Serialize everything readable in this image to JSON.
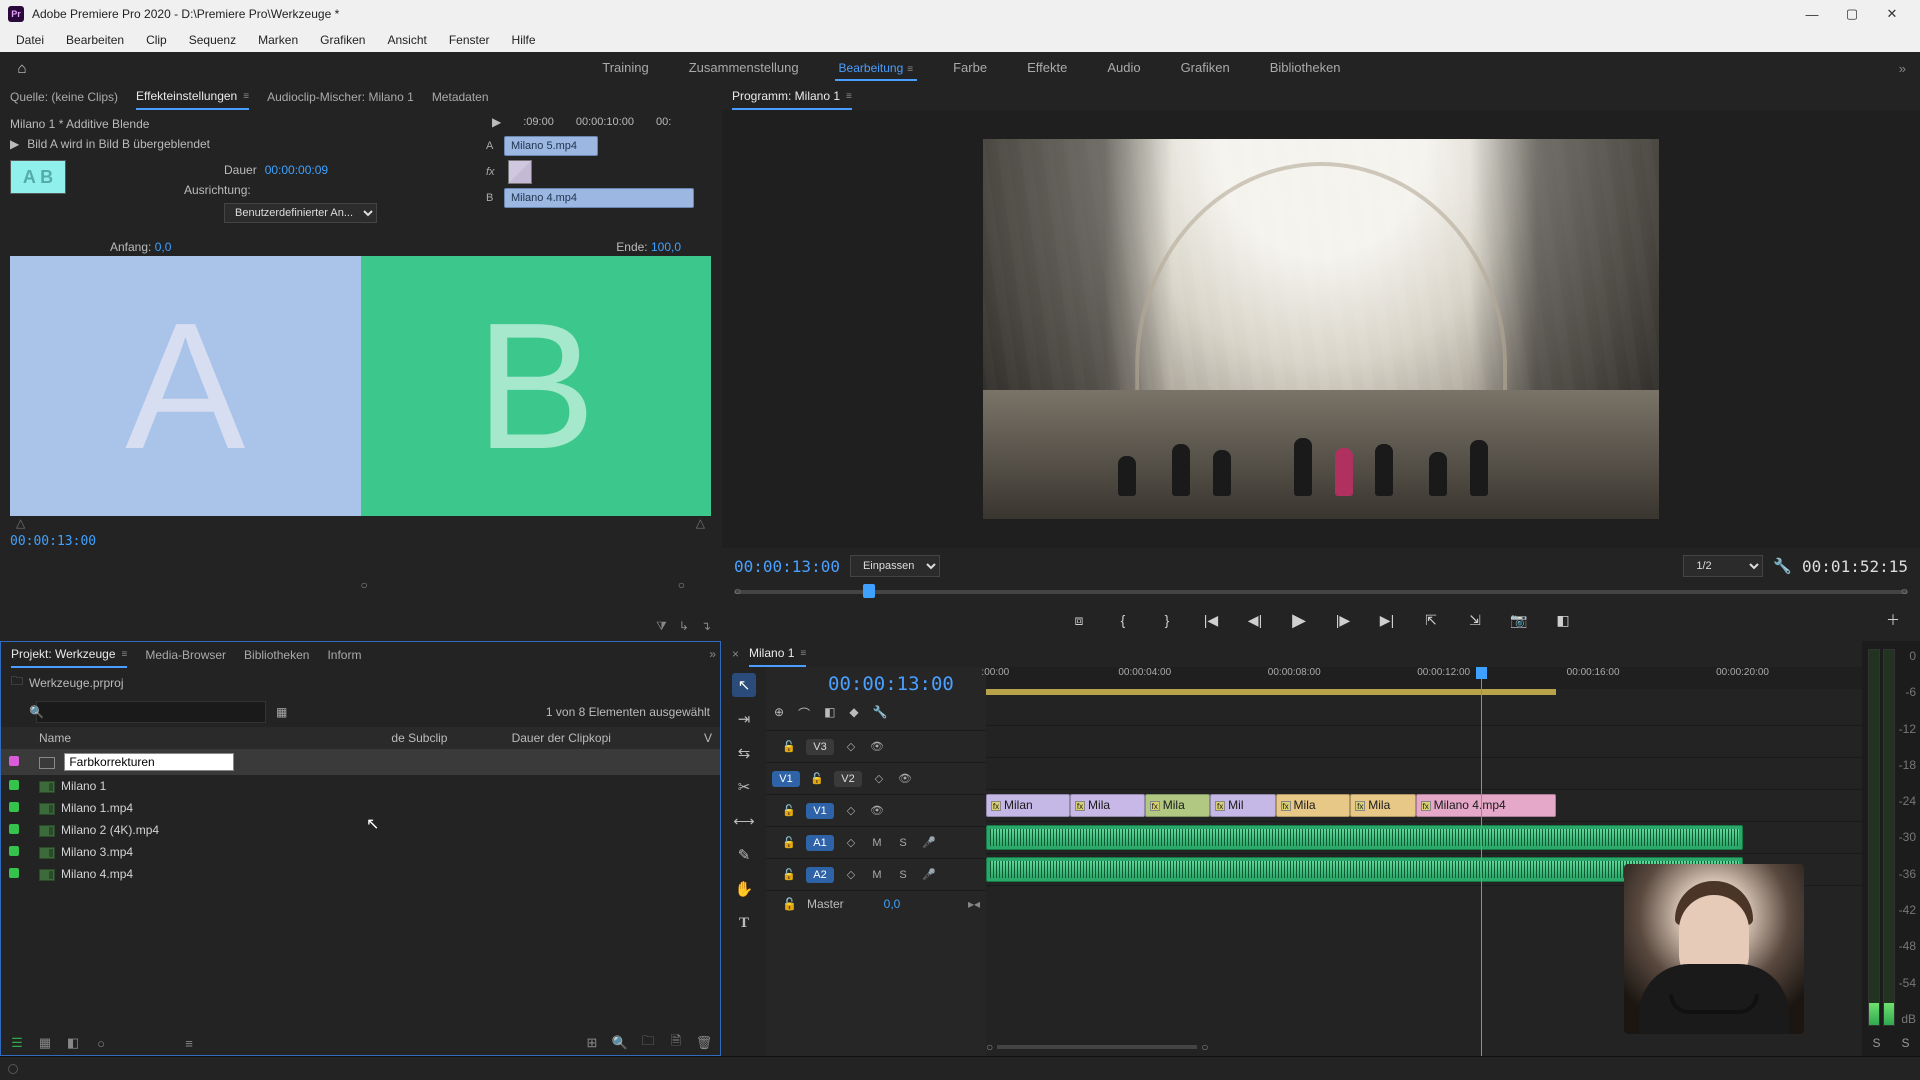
{
  "window": {
    "title": "Adobe Premiere Pro 2020 - D:\\Premiere Pro\\Werkzeuge *",
    "logo_text": "Pr"
  },
  "menu": [
    "Datei",
    "Bearbeiten",
    "Clip",
    "Sequenz",
    "Marken",
    "Grafiken",
    "Ansicht",
    "Fenster",
    "Hilfe"
  ],
  "workspaces": {
    "items": [
      "Training",
      "Zusammenstellung",
      "Bearbeitung",
      "Farbe",
      "Effekte",
      "Audio",
      "Grafiken",
      "Bibliotheken"
    ],
    "active": "Bearbeitung"
  },
  "source_tabs": {
    "items": [
      "Quelle: (keine Clips)",
      "Effekteinstellungen",
      "Audioclip-Mischer: Milano 1",
      "Metadaten"
    ],
    "active": "Effekteinstellungen"
  },
  "effect_controls": {
    "breadcrumb": "Milano 1 * Additive Blende",
    "desc": "Bild A wird in Bild B übergeblendet",
    "dauer_label": "Dauer",
    "dauer_value": "00:00:00:09",
    "ausrichtung_label": "Ausrichtung:",
    "ausrichtung_value": "Benutzerdefinierter An...",
    "anfang_label": "Anfang:",
    "anfang_value": "0,0",
    "ende_label": "Ende:",
    "ende_value": "100,0",
    "a_letter": "A",
    "b_letter": "B",
    "timecode": "00:00:13:00",
    "mini_timeline": {
      "ticks": [
        ":09:00",
        "00:00:10:00",
        "00:"
      ],
      "track_a_label": "A",
      "track_a_clip": "Milano 5.mp4",
      "fx_label": "fx",
      "track_b_label": "B",
      "track_b_clip": "Milano 4.mp4"
    }
  },
  "program": {
    "tab": "Programm: Milano 1",
    "timecode": "00:00:13:00",
    "fit_label": "Einpassen",
    "zoom_label": "1/2",
    "duration": "00:01:52:15",
    "playhead_pct": 11
  },
  "project_tabs": {
    "items": [
      "Projekt: Werkzeuge",
      "Media-Browser",
      "Bibliotheken",
      "Inform"
    ],
    "active": "Projekt: Werkzeuge"
  },
  "project": {
    "file_label": "Werkzeuge.prproj",
    "selection_text": "1 von 8 Elementen ausgewählt",
    "search_placeholder": "",
    "columns": [
      "Name",
      "de Subclip",
      "Dauer der Clipkopi",
      "V"
    ],
    "rename_value": "Farbkorrekturen",
    "items": [
      {
        "label_color": "#d85bd8",
        "icon": "adj",
        "name": "Farbkorrekturen",
        "editing": true
      },
      {
        "label_color": "#35c24d",
        "icon": "seq",
        "name": "Milano 1"
      },
      {
        "label_color": "#35c24d",
        "icon": "clip",
        "name": "Milano 1.mp4"
      },
      {
        "label_color": "#35c24d",
        "icon": "clip",
        "name": "Milano 2 (4K).mp4"
      },
      {
        "label_color": "#35c24d",
        "icon": "clip",
        "name": "Milano 3.mp4"
      },
      {
        "label_color": "#35c24d",
        "icon": "clip",
        "name": "Milano 4.mp4"
      }
    ]
  },
  "timeline": {
    "tab": "Milano 1",
    "timecode": "00:00:13:00",
    "ruler": [
      {
        "label": ":00:00",
        "pct": 1
      },
      {
        "label": "00:00:04:00",
        "pct": 17
      },
      {
        "label": "00:00:08:00",
        "pct": 33
      },
      {
        "label": "00:00:12:00",
        "pct": 49
      },
      {
        "label": "00:00:16:00",
        "pct": 65
      },
      {
        "label": "00:00:20:00",
        "pct": 81
      }
    ],
    "playhead_pct": 53,
    "workrange_end_pct": 61,
    "tracks_video": [
      {
        "name": "V3",
        "locked": false
      },
      {
        "name": "V2",
        "locked": false,
        "source": "V1"
      },
      {
        "name": "V1",
        "locked": false,
        "blue": true
      }
    ],
    "tracks_audio": [
      {
        "name": "A1",
        "blue": true,
        "m": "M",
        "s": "S"
      },
      {
        "name": "A2",
        "blue": true,
        "m": "M",
        "s": "S"
      }
    ],
    "master_label": "Master",
    "master_value": "0,0",
    "v1_clips": [
      {
        "name": "Milan",
        "start": 0,
        "end": 9,
        "cls": "v"
      },
      {
        "name": "Mila",
        "start": 9,
        "end": 17,
        "cls": "v4"
      },
      {
        "name": "Mila",
        "start": 17,
        "end": 24,
        "cls": "v3"
      },
      {
        "name": "Mil",
        "start": 24,
        "end": 31,
        "cls": "v"
      },
      {
        "name": "Mila",
        "start": 31,
        "end": 39,
        "cls": "v5"
      },
      {
        "name": "Mila",
        "start": 39,
        "end": 46,
        "cls": "v5"
      },
      {
        "name": "Milano 4.mp4",
        "start": 46,
        "end": 61,
        "cls": "v6"
      }
    ],
    "audio_extent_pct": 81
  },
  "meter_ticks": [
    "0",
    "-6",
    "-12",
    "-18",
    "-24",
    "-30",
    "-36",
    "-42",
    "-48",
    "-54",
    "dB"
  ],
  "meter_solo": "S"
}
